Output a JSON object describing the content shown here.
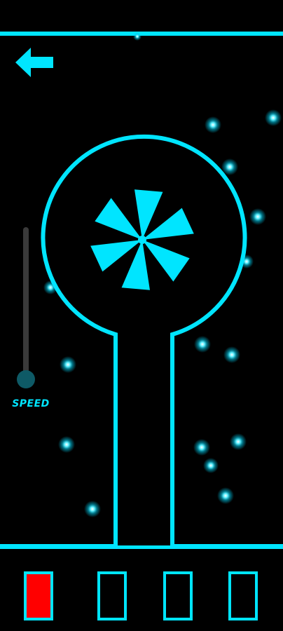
{
  "theme": {
    "accent": "#00e5ff",
    "background": "#000000",
    "particle": "#22d8ff",
    "slot_filled": "#ff0000"
  },
  "nav": {
    "back_icon": "arrow-left-icon"
  },
  "speed": {
    "label": "SPEED",
    "value": 0.0
  },
  "fan": {
    "blade_count": 6,
    "icon": "fan-icon"
  },
  "slots": [
    {
      "state": "filled"
    },
    {
      "state": "empty"
    },
    {
      "state": "empty"
    },
    {
      "state": "empty"
    }
  ],
  "particle_count": 20
}
